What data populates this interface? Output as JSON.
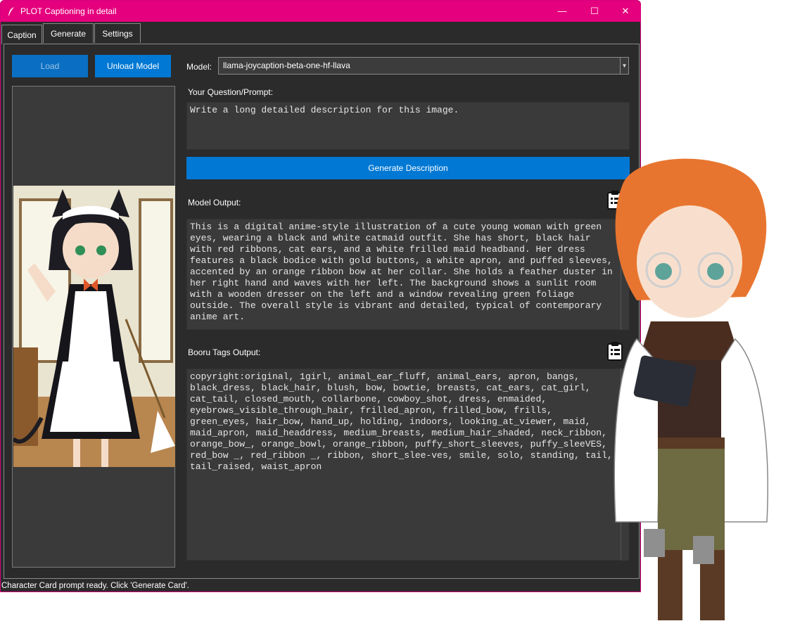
{
  "window": {
    "title": "PLOT Captioning in detail"
  },
  "tabs": [
    {
      "label": "Caption"
    },
    {
      "label": "Generate"
    },
    {
      "label": "Settings"
    }
  ],
  "buttons": {
    "load": "Load",
    "unload": "Unload Model",
    "generate": "Generate Description"
  },
  "model": {
    "label": "Model:",
    "value": "llama-joycaption-beta-one-hf-llava"
  },
  "prompt": {
    "label": "Your Question/Prompt:",
    "value": "Write a long detailed description for this image."
  },
  "model_output": {
    "label": "Model Output:",
    "value": "This is a digital anime-style illustration of a cute young woman with green eyes, wearing a black and white catmaid outfit. She has short, black hair with red ribbons, cat ears, and a white frilled maid headband. Her dress features a black bodice with gold buttons, a white apron, and puffed sleeves, accented by an orange ribbon bow at her collar. She holds a feather duster in her right hand and waves with her left. The background shows a sunlit room with a wooden dresser on the left and a window revealing green foliage outside. The overall style is vibrant and detailed, typical of contemporary anime art."
  },
  "tags_output": {
    "label": "Booru Tags Output:",
    "value": "copyright:original, 1girl, animal_ear_fluff, animal_ears, apron, bangs, black_dress, black_hair, blush, bow, bowtie, breasts, cat_ears, cat_girl, cat_tail, closed_mouth, collarbone, cowboy_shot, dress, enmaided, eyebrows_visible_through_hair, frilled_apron, frilled_bow, frills, green_eyes, hair_bow, hand_up, holding, indoors, looking_at_viewer, maid, maid_apron, maid_headdress, medium_breasts, medium_hair_shaded, neck_ribbon, orange_bow_, orange_bowl, orange_ribbon, puffy_short_sleeves, puffy_sleeVES, red_bow _, red_ribbon _, ribbon, short_slee-ves, smile, solo, standing, tail, tail_raised, waist_apron"
  },
  "status": {
    "text": "Character Card prompt ready. Click 'Generate Card'."
  },
  "colors": {
    "titlebar": "#e5007d",
    "button": "#0078d4",
    "panel": "#2b2b2b"
  },
  "icons": [
    "feather-icon",
    "minimize-icon",
    "maximize-icon",
    "close-icon",
    "clipboard-icon",
    "dropdown-arrow-icon"
  ]
}
